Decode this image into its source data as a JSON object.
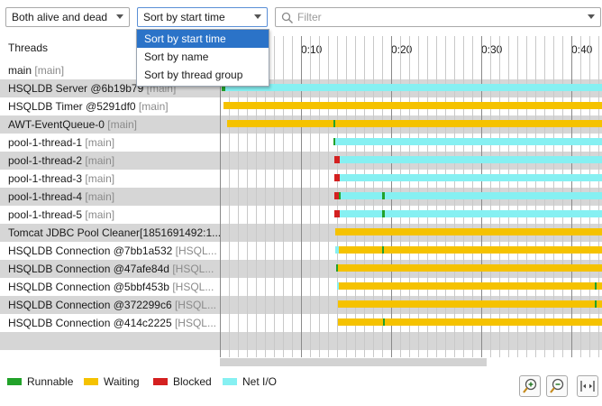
{
  "toolbar": {
    "liveness_value": "Both alive and dead",
    "sort_value": "Sort by start time",
    "filter_placeholder": "Filter"
  },
  "sort_menu": {
    "options": [
      "Sort by start time",
      "Sort by name",
      "Sort by thread group"
    ],
    "selected_index": 0
  },
  "timeline": {
    "header_label": "Threads",
    "tick_labels": [
      "0:10",
      "0:20",
      "0:30",
      "0:40"
    ]
  },
  "threads": [
    {
      "name": "main",
      "group": "[main]"
    },
    {
      "name": "HSQLDB Server @6b19b79",
      "group": "[main]"
    },
    {
      "name": "HSQLDB Timer @5291df0",
      "group": "[main]"
    },
    {
      "name": "AWT-EventQueue-0",
      "group": "[main]"
    },
    {
      "name": "pool-1-thread-1",
      "group": "[main]"
    },
    {
      "name": "pool-1-thread-2",
      "group": "[main]"
    },
    {
      "name": "pool-1-thread-3",
      "group": "[main]"
    },
    {
      "name": "pool-1-thread-4",
      "group": "[main]"
    },
    {
      "name": "pool-1-thread-5",
      "group": "[main]"
    },
    {
      "name": "Tomcat JDBC Pool Cleaner[1851691492:1...",
      "group": ""
    },
    {
      "name": "HSQLDB Connection @7bb1a532",
      "group": "[HSQL..."
    },
    {
      "name": "HSQLDB Connection @47afe84d",
      "group": "[HSQL..."
    },
    {
      "name": "HSQLDB Connection @5bbf453b",
      "group": "[HSQL..."
    },
    {
      "name": "HSQLDB Connection @372299c6",
      "group": "[HSQL..."
    },
    {
      "name": "HSQLDB Connection @414c2225",
      "group": "[HSQL..."
    }
  ],
  "legend": [
    {
      "label": "Runnable",
      "color": "#22a22a"
    },
    {
      "label": "Waiting",
      "color": "#f5c200"
    },
    {
      "label": "Blocked",
      "color": "#d42020"
    },
    {
      "label": "Net I/O",
      "color": "#86f0f2"
    }
  ],
  "zoom": {
    "zoom_in_icon": "zoom-in-icon",
    "zoom_out_icon": "zoom-out-icon",
    "fit_icon": "fit-width-icon"
  }
}
